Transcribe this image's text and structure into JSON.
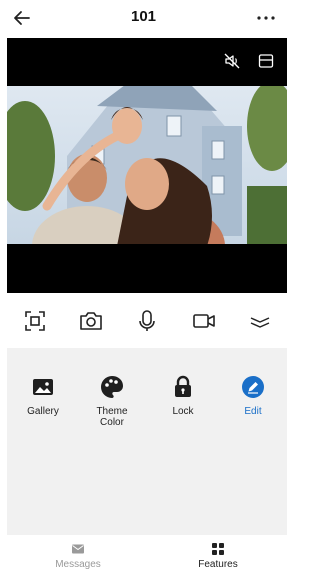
{
  "header": {
    "title": "101"
  },
  "controls": [
    {
      "name": "screenshot"
    },
    {
      "name": "snapshot"
    },
    {
      "name": "microphone"
    },
    {
      "name": "record"
    },
    {
      "name": "collapse"
    }
  ],
  "features": [
    {
      "label": "Gallery",
      "icon": "gallery-icon"
    },
    {
      "label": "Theme\nColor",
      "icon": "palette-icon"
    },
    {
      "label": "Lock",
      "icon": "lock-icon"
    },
    {
      "label": "Edit",
      "icon": "edit-icon",
      "active": true
    }
  ],
  "nav": {
    "messages": {
      "label": "Messages",
      "icon": "mail-icon",
      "color": "#9a9a9a"
    },
    "features": {
      "label": "Features",
      "icon": "grid-icon",
      "color": "#222222"
    }
  },
  "colors": {
    "accent": "#1a6fc8",
    "panel": "#f1f1f1",
    "video_bg": "#000000"
  }
}
